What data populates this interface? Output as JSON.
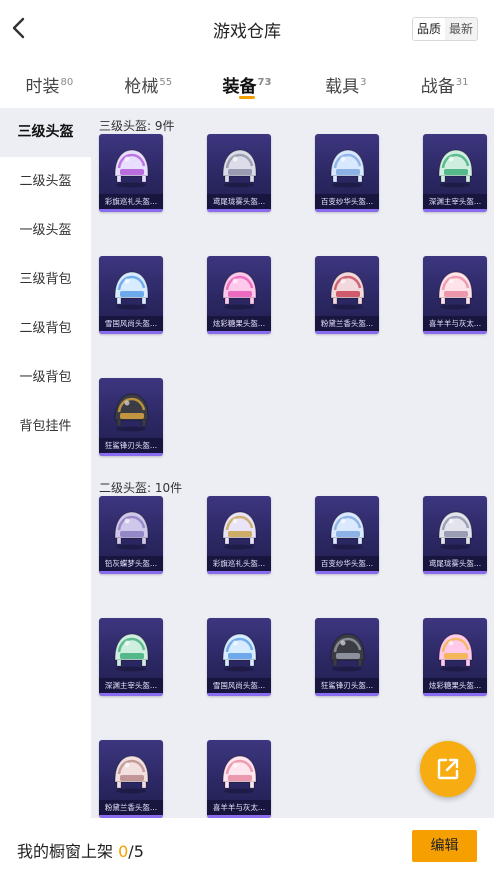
{
  "header": {
    "title": "游戏仓库",
    "sort_options": [
      "品质",
      "最新"
    ],
    "sort_active": "品质"
  },
  "tabs": [
    {
      "label": "时装",
      "count": "80"
    },
    {
      "label": "枪械",
      "count": "55"
    },
    {
      "label": "装备",
      "count": "73"
    },
    {
      "label": "载具",
      "count": "3"
    },
    {
      "label": "战备",
      "count": "31"
    }
  ],
  "active_tab": "装备",
  "sidebar": {
    "items": [
      "三级头盔",
      "二级头盔",
      "一级头盔",
      "三级背包",
      "二级背包",
      "一级背包",
      "背包挂件"
    ],
    "active": "三级头盔"
  },
  "sections": [
    {
      "title": "三级头盔: 9件",
      "items": [
        {
          "name": "彩旗巡礼头盔...",
          "icon": "helmet-festive-icon",
          "color": "#e8dfff",
          "accent": "#b25bd8"
        },
        {
          "name": "鸢尾珑雾头盔...",
          "icon": "helmet-iris-icon",
          "color": "#dcdde8",
          "accent": "#8d90a8"
        },
        {
          "name": "百变纱华头盔...",
          "icon": "helmet-crystal-icon",
          "color": "#d8e8ff",
          "accent": "#7fa8e0"
        },
        {
          "name": "深渊主宰头盔...",
          "icon": "helmet-abyss-icon",
          "color": "#cfeee0",
          "accent": "#3fae7a"
        },
        {
          "name": "雪国风尚头盔...",
          "icon": "helmet-snow-icon",
          "color": "#d7ecff",
          "accent": "#5a9ee8"
        },
        {
          "name": "炫彩糖果头盔...",
          "icon": "helmet-candy-icon",
          "color": "#ffc9ec",
          "accent": "#e85bb8"
        },
        {
          "name": "粉黛兰香头盔...",
          "icon": "helmet-pink-icon",
          "color": "#f2d9dd",
          "accent": "#c94458"
        },
        {
          "name": "喜羊羊与灰太...",
          "icon": "helmet-sheep-icon",
          "color": "#ffe3ea",
          "accent": "#ea8aa2"
        },
        {
          "name": "狂鲨锋刃头盔...",
          "icon": "helmet-shark-icon",
          "color": "#3c3c44",
          "accent": "#d9a640"
        }
      ]
    },
    {
      "title": "二级头盔: 10件",
      "items": [
        {
          "name": "铅灰蝶梦头盔...",
          "icon": "helmet-butterfly-icon",
          "color": "#cfc8ea",
          "accent": "#8b7cc2"
        },
        {
          "name": "彩旗巡礼头盔...",
          "icon": "helmet-festive-icon",
          "color": "#eae4f8",
          "accent": "#c7a24e"
        },
        {
          "name": "百变纱华头盔...",
          "icon": "helmet-crystal-icon",
          "color": "#dbe9ff",
          "accent": "#7fa8e0"
        },
        {
          "name": "鸢尾珑雾头盔...",
          "icon": "helmet-iris-icon",
          "color": "#e4e4ee",
          "accent": "#8d90a8"
        },
        {
          "name": "深渊主宰头盔...",
          "icon": "helmet-abyss-icon",
          "color": "#cfeee0",
          "accent": "#3fae7a"
        },
        {
          "name": "雪国风尚头盔...",
          "icon": "helmet-snow-icon",
          "color": "#d7ecff",
          "accent": "#5a9ee8"
        },
        {
          "name": "狂鲨锋刃头盔...",
          "icon": "helmet-shark-icon",
          "color": "#3c3c44",
          "accent": "#9aa0aa"
        },
        {
          "name": "炫彩糖果头盔...",
          "icon": "helmet-candy-icon",
          "color": "#ffc9ec",
          "accent": "#f2b441"
        },
        {
          "name": "粉黛兰香头盔...",
          "icon": "helmet-pink-icon",
          "color": "#f2e0e0",
          "accent": "#b98a8a"
        },
        {
          "name": "喜羊羊与灰太...",
          "icon": "helmet-sheep-icon",
          "color": "#ffe6ee",
          "accent": "#ea8aa2"
        }
      ]
    }
  ],
  "bottom_bar": {
    "showcase_label": "我的橱窗上架",
    "showcase_current": "0",
    "showcase_total": "/5",
    "edit_label": "编辑"
  },
  "colors": {
    "accent": "#f5a000",
    "card_bg": "#2a2660",
    "content_bg": "#eceef3"
  }
}
